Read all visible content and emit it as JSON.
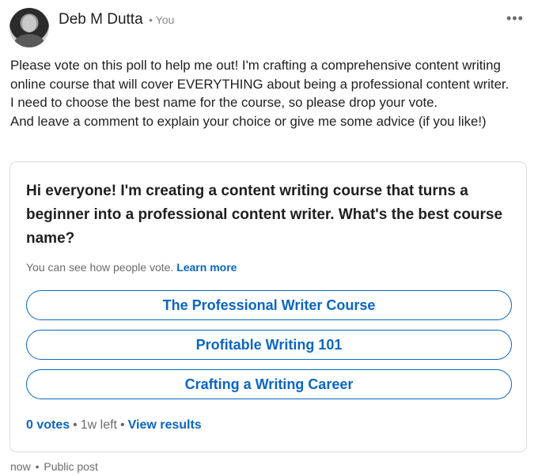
{
  "author": {
    "name": "Deb M Dutta",
    "relation": "You",
    "separator": "•"
  },
  "post": {
    "paragraphs": [
      "Please vote on this poll to help me out! I'm crafting a comprehensive content writing online course that will cover EVERYTHING about being a professional content writer.",
      "I need to choose the best name for the course, so please drop your vote.",
      "And leave a comment to explain your choice or give me some advice (if you like!)"
    ],
    "time": "now",
    "visibility": "Public post"
  },
  "poll": {
    "question": "Hi everyone! I'm creating a content writing course that turns a beginner into a professional content writer. What's the best course name?",
    "notice": "You can see how people vote.",
    "learn_more": "Learn more",
    "options": [
      "The Professional Writer Course",
      "Profitable Writing 101",
      "Crafting a Writing Career"
    ],
    "votes": "0 votes",
    "time_left": "1w left",
    "view_results": "View results"
  },
  "colors": {
    "accent": "#0a66c2",
    "muted": "#6b6b6b",
    "text": "#1f1f1f",
    "border": "#dcdcdc"
  },
  "icons": {
    "more": "more-horizontal-icon"
  }
}
